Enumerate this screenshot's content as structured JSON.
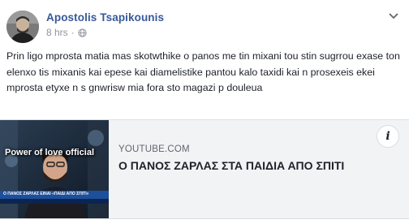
{
  "post": {
    "author": "Apostolis Tsapikounis",
    "time": "8 hrs",
    "separator": "·",
    "privacy_icon": "globe-icon",
    "menu_icon": "chevron-down-icon",
    "text": "Prin ligo mprosta matia mas skotwthike o panos me tin mixani tou stin sugrrou exase ton elenxo tis mixanis kai epese kai diamelistike pantou kalo taxidi kai n prosexeis ekei mprosta etyxe n s gnwrisw mia fora sto magazi p douleua"
  },
  "link_card": {
    "thumbnail_overlay": "Power of love official",
    "thumbnail_caption": "Ο ΠΑΝΟΣ ΖΑΡΛΑΣ ΕΙΝΑΙ «ΠΑΙΔΙ ΑΠΟ ΣΠΙΤΙ»",
    "source": "YOUTUBE.COM",
    "title": "Ο ΠΑΝΟΣ ΖΑΡΛΑΣ ΣΤΑ ΠΑΙΔΙΑ ΑΠΟ ΣΠΙΤΙ",
    "info_label": "i"
  },
  "colors": {
    "author_link": "#385898",
    "meta_text": "#90949c",
    "card_bg": "#f2f3f5",
    "overlay_text": "#ffffff"
  }
}
